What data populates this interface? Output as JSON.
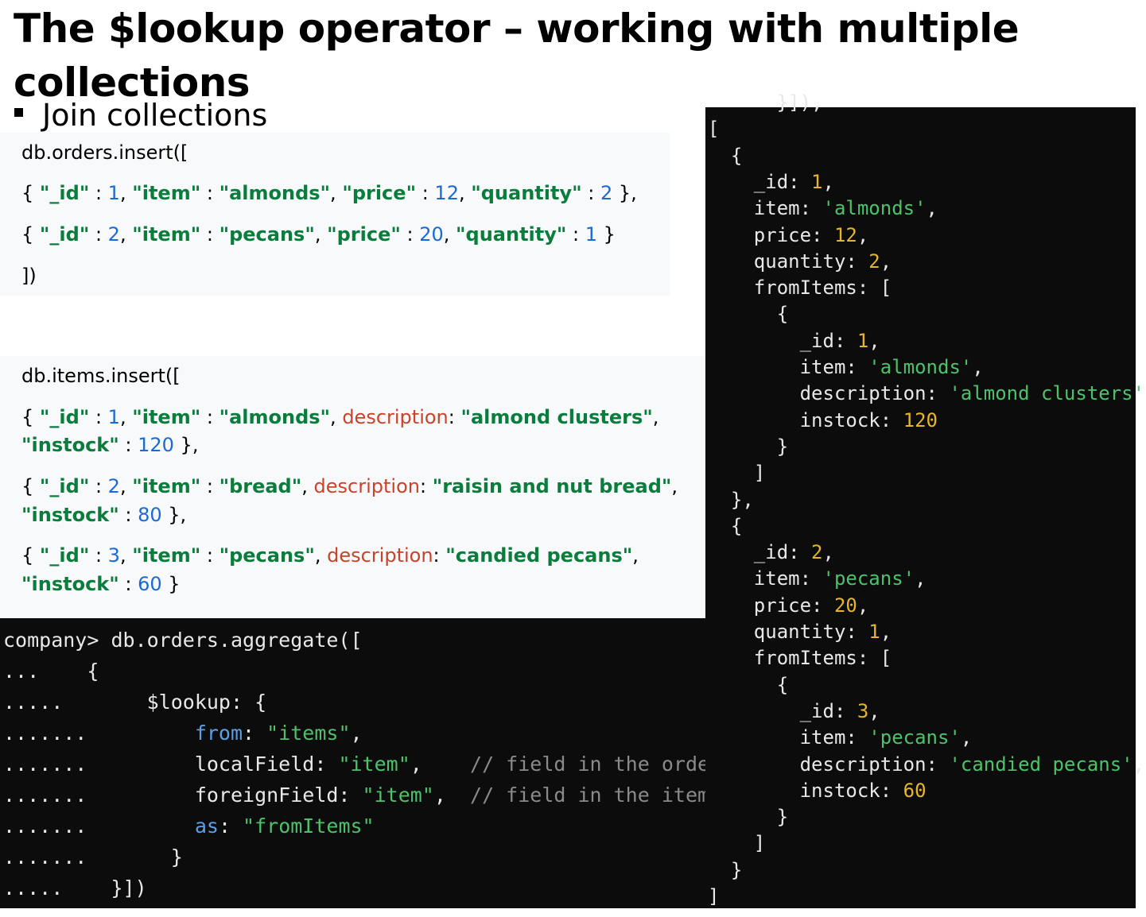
{
  "title": "The $lookup operator – working with multiple collections",
  "bullet": "Join collections",
  "orders_code": {
    "l0": "db.orders.insert([",
    "l1": [
      {
        "t": "{ ",
        "c": "p"
      },
      {
        "t": "\"_id\"",
        "c": "k"
      },
      {
        "t": " : ",
        "c": "p"
      },
      {
        "t": "1",
        "c": "n"
      },
      {
        "t": ", ",
        "c": "p"
      },
      {
        "t": "\"item\"",
        "c": "k"
      },
      {
        "t": " : ",
        "c": "p"
      },
      {
        "t": "\"almonds\"",
        "c": "k"
      },
      {
        "t": ", ",
        "c": "p"
      },
      {
        "t": "\"price\"",
        "c": "k"
      },
      {
        "t": " : ",
        "c": "p"
      },
      {
        "t": "12",
        "c": "n"
      },
      {
        "t": ", ",
        "c": "p"
      },
      {
        "t": "\"quantity\"",
        "c": "k"
      },
      {
        "t": " : ",
        "c": "p"
      },
      {
        "t": "2",
        "c": "n"
      },
      {
        "t": " },",
        "c": "p"
      }
    ],
    "l2": [
      {
        "t": "{ ",
        "c": "p"
      },
      {
        "t": "\"_id\"",
        "c": "k"
      },
      {
        "t": " : ",
        "c": "p"
      },
      {
        "t": "2",
        "c": "n"
      },
      {
        "t": ", ",
        "c": "p"
      },
      {
        "t": "\"item\"",
        "c": "k"
      },
      {
        "t": " : ",
        "c": "p"
      },
      {
        "t": "\"pecans\"",
        "c": "k"
      },
      {
        "t": ", ",
        "c": "p"
      },
      {
        "t": "\"price\"",
        "c": "k"
      },
      {
        "t": " : ",
        "c": "p"
      },
      {
        "t": "20",
        "c": "n"
      },
      {
        "t": ", ",
        "c": "p"
      },
      {
        "t": "\"quantity\"",
        "c": "k"
      },
      {
        "t": " : ",
        "c": "p"
      },
      {
        "t": "1",
        "c": "n"
      },
      {
        "t": " }",
        "c": "p"
      }
    ],
    "l3": "])"
  },
  "items_code": {
    "l0": "db.items.insert([",
    "l1a": [
      {
        "t": "{ ",
        "c": "p"
      },
      {
        "t": "\"_id\"",
        "c": "k"
      },
      {
        "t": " : ",
        "c": "p"
      },
      {
        "t": "1",
        "c": "n"
      },
      {
        "t": ", ",
        "c": "p"
      },
      {
        "t": "\"item\"",
        "c": "k"
      },
      {
        "t": " : ",
        "c": "p"
      },
      {
        "t": "\"almonds\"",
        "c": "k"
      },
      {
        "t": ", ",
        "c": "p"
      },
      {
        "t": "description",
        "c": "d"
      },
      {
        "t": ": ",
        "c": "p"
      },
      {
        "t": "\"almond clusters\"",
        "c": "k"
      },
      {
        "t": ",",
        "c": "p"
      }
    ],
    "l1b": [
      {
        "t": "\"instock\"",
        "c": "k"
      },
      {
        "t": " : ",
        "c": "p"
      },
      {
        "t": "120",
        "c": "n"
      },
      {
        "t": " },",
        "c": "p"
      }
    ],
    "l2a": [
      {
        "t": "{ ",
        "c": "p"
      },
      {
        "t": "\"_id\"",
        "c": "k"
      },
      {
        "t": " : ",
        "c": "p"
      },
      {
        "t": "2",
        "c": "n"
      },
      {
        "t": ", ",
        "c": "p"
      },
      {
        "t": "\"item\"",
        "c": "k"
      },
      {
        "t": " : ",
        "c": "p"
      },
      {
        "t": "\"bread\"",
        "c": "k"
      },
      {
        "t": ", ",
        "c": "p"
      },
      {
        "t": "description",
        "c": "d"
      },
      {
        "t": ": ",
        "c": "p"
      },
      {
        "t": "\"raisin and nut bread\"",
        "c": "k"
      },
      {
        "t": ",",
        "c": "p"
      }
    ],
    "l2b": [
      {
        "t": "\"instock\"",
        "c": "k"
      },
      {
        "t": " : ",
        "c": "p"
      },
      {
        "t": "80",
        "c": "n"
      },
      {
        "t": " },",
        "c": "p"
      }
    ],
    "l3a": [
      {
        "t": "{ ",
        "c": "p"
      },
      {
        "t": "\"_id\"",
        "c": "k"
      },
      {
        "t": " : ",
        "c": "p"
      },
      {
        "t": "3",
        "c": "n"
      },
      {
        "t": ", ",
        "c": "p"
      },
      {
        "t": "\"item\"",
        "c": "k"
      },
      {
        "t": " : ",
        "c": "p"
      },
      {
        "t": "\"pecans\"",
        "c": "k"
      },
      {
        "t": ", ",
        "c": "p"
      },
      {
        "t": "description",
        "c": "d"
      },
      {
        "t": ": ",
        "c": "p"
      },
      {
        "t": "\"candied pecans\"",
        "c": "k"
      },
      {
        "t": ",",
        "c": "p"
      }
    ],
    "l3b": [
      {
        "t": "\"instock\"",
        "c": "k"
      },
      {
        "t": " : ",
        "c": "p"
      },
      {
        "t": "60",
        "c": "n"
      },
      {
        "t": " }",
        "c": "p"
      }
    ]
  },
  "aggregate_terminal": [
    [
      {
        "t": "company> db.orders.aggregate([",
        "c": "w"
      }
    ],
    [
      {
        "t": "...    {",
        "c": "w"
      }
    ],
    [
      {
        "t": ".....       $lookup: {",
        "c": "w"
      }
    ],
    [
      {
        "t": ".......         ",
        "c": "w"
      },
      {
        "t": "from",
        "c": "b"
      },
      {
        "t": ": ",
        "c": "w"
      },
      {
        "t": "\"items\"",
        "c": "g"
      },
      {
        "t": ",",
        "c": "w"
      }
    ],
    [
      {
        "t": ".......         localField: ",
        "c": "w"
      },
      {
        "t": "\"item\"",
        "c": "g"
      },
      {
        "t": ",    ",
        "c": "w"
      },
      {
        "t": "// field in the orders collection",
        "c": "c"
      }
    ],
    [
      {
        "t": ".......         foreignField: ",
        "c": "w"
      },
      {
        "t": "\"item\"",
        "c": "g"
      },
      {
        "t": ",  ",
        "c": "w"
      },
      {
        "t": "// field in the items collection",
        "c": "c"
      }
    ],
    [
      {
        "t": ".......         ",
        "c": "w"
      },
      {
        "t": "as",
        "c": "b"
      },
      {
        "t": ": ",
        "c": "w"
      },
      {
        "t": "\"fromItems\"",
        "c": "g"
      }
    ],
    [
      {
        "t": ".......       }",
        "c": "w"
      }
    ],
    [
      {
        "t": ".....    }])",
        "c": "w"
      }
    ]
  ],
  "result_terminal": [
    [
      {
        "t": "      }]),",
        "c": "w"
      }
    ],
    [
      {
        "t": "[",
        "c": "w"
      }
    ],
    [
      {
        "t": "  {",
        "c": "w"
      }
    ],
    [
      {
        "t": "    _id: ",
        "c": "w"
      },
      {
        "t": "1",
        "c": "y"
      },
      {
        "t": ",",
        "c": "w"
      }
    ],
    [
      {
        "t": "    item: ",
        "c": "w"
      },
      {
        "t": "'almonds'",
        "c": "g"
      },
      {
        "t": ",",
        "c": "w"
      }
    ],
    [
      {
        "t": "    price: ",
        "c": "w"
      },
      {
        "t": "12",
        "c": "y"
      },
      {
        "t": ",",
        "c": "w"
      }
    ],
    [
      {
        "t": "    quantity: ",
        "c": "w"
      },
      {
        "t": "2",
        "c": "y"
      },
      {
        "t": ",",
        "c": "w"
      }
    ],
    [
      {
        "t": "    fromItems: [",
        "c": "w"
      }
    ],
    [
      {
        "t": "      {",
        "c": "w"
      }
    ],
    [
      {
        "t": "        _id: ",
        "c": "w"
      },
      {
        "t": "1",
        "c": "y"
      },
      {
        "t": ",",
        "c": "w"
      }
    ],
    [
      {
        "t": "        item: ",
        "c": "w"
      },
      {
        "t": "'almonds'",
        "c": "g"
      },
      {
        "t": ",",
        "c": "w"
      }
    ],
    [
      {
        "t": "        description: ",
        "c": "w"
      },
      {
        "t": "'almond clusters'",
        "c": "g"
      },
      {
        "t": ",",
        "c": "w"
      }
    ],
    [
      {
        "t": "        instock: ",
        "c": "w"
      },
      {
        "t": "120",
        "c": "y"
      }
    ],
    [
      {
        "t": "      }",
        "c": "w"
      }
    ],
    [
      {
        "t": "    ]",
        "c": "w"
      }
    ],
    [
      {
        "t": "  },",
        "c": "w"
      }
    ],
    [
      {
        "t": "  {",
        "c": "w"
      }
    ],
    [
      {
        "t": "    _id: ",
        "c": "w"
      },
      {
        "t": "2",
        "c": "y"
      },
      {
        "t": ",",
        "c": "w"
      }
    ],
    [
      {
        "t": "    item: ",
        "c": "w"
      },
      {
        "t": "'pecans'",
        "c": "g"
      },
      {
        "t": ",",
        "c": "w"
      }
    ],
    [
      {
        "t": "    price: ",
        "c": "w"
      },
      {
        "t": "20",
        "c": "y"
      },
      {
        "t": ",",
        "c": "w"
      }
    ],
    [
      {
        "t": "    quantity: ",
        "c": "w"
      },
      {
        "t": "1",
        "c": "y"
      },
      {
        "t": ",",
        "c": "w"
      }
    ],
    [
      {
        "t": "    fromItems: [",
        "c": "w"
      }
    ],
    [
      {
        "t": "      {",
        "c": "w"
      }
    ],
    [
      {
        "t": "        _id: ",
        "c": "w"
      },
      {
        "t": "3",
        "c": "y"
      },
      {
        "t": ",",
        "c": "w"
      }
    ],
    [
      {
        "t": "        item: ",
        "c": "w"
      },
      {
        "t": "'pecans'",
        "c": "g"
      },
      {
        "t": ",",
        "c": "w"
      }
    ],
    [
      {
        "t": "        description: ",
        "c": "w"
      },
      {
        "t": "'candied pecans'",
        "c": "g"
      },
      {
        "t": ",",
        "c": "w"
      }
    ],
    [
      {
        "t": "        instock: ",
        "c": "w"
      },
      {
        "t": "60",
        "c": "y"
      }
    ],
    [
      {
        "t": "      }",
        "c": "w"
      }
    ],
    [
      {
        "t": "    ]",
        "c": "w"
      }
    ],
    [
      {
        "t": "  }",
        "c": "w"
      }
    ],
    [
      {
        "t": "]",
        "c": "w"
      }
    ]
  ]
}
